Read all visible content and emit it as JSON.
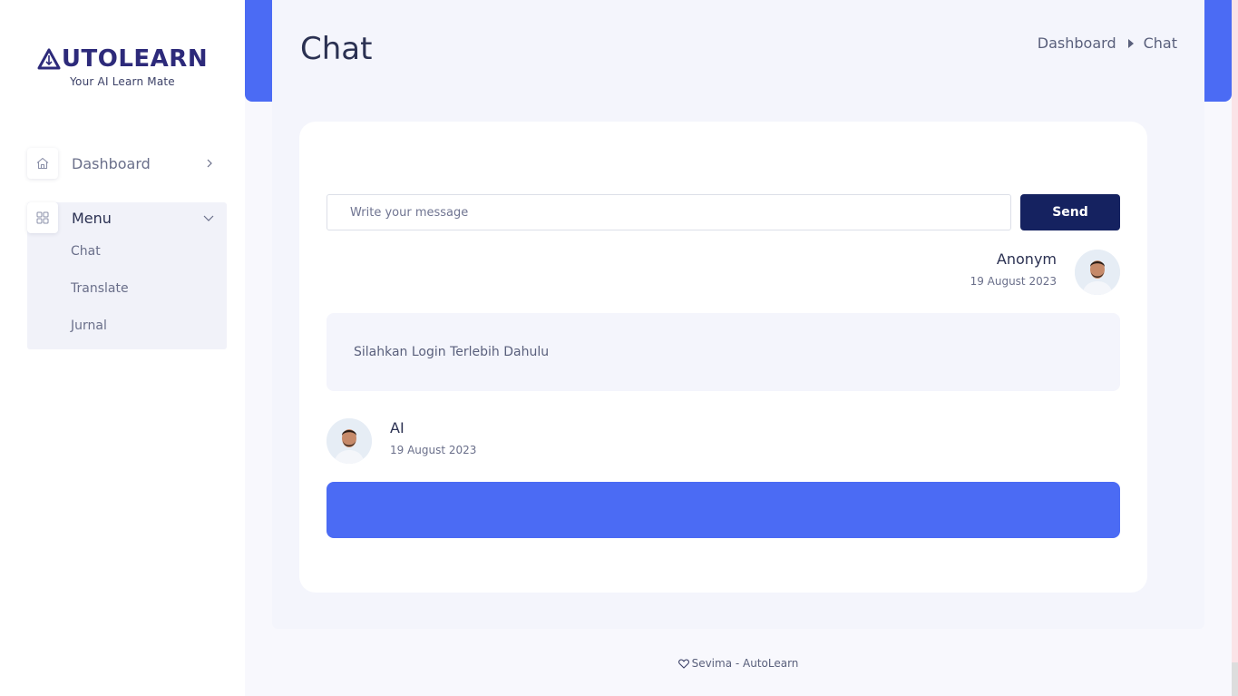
{
  "brand": {
    "logo_text": "UTOLEARN",
    "tagline": "Your AI Learn Mate"
  },
  "sidebar": {
    "items": [
      {
        "label": "Dashboard",
        "icon": "home-icon"
      },
      {
        "label": "Menu",
        "icon": "grid-icon"
      }
    ],
    "submenu": [
      {
        "label": "Chat"
      },
      {
        "label": "Translate"
      },
      {
        "label": "Jurnal"
      }
    ]
  },
  "header": {
    "title": "Chat",
    "breadcrumb": [
      "Dashboard",
      "Chat"
    ]
  },
  "chat": {
    "input_placeholder": "Write your message",
    "send_label": "Send",
    "messages": [
      {
        "sender": "Anonym",
        "date": "19 August 2023",
        "text": "Silahkan Login Terlebih Dahulu",
        "side": "right"
      },
      {
        "sender": "AI",
        "date": "19 August 2023",
        "text": "",
        "side": "left"
      }
    ]
  },
  "footer": {
    "text": "Sevima - AutoLearn"
  },
  "colors": {
    "accent": "#4b6bf4",
    "button": "#152260",
    "brand": "#2d2a7a"
  }
}
